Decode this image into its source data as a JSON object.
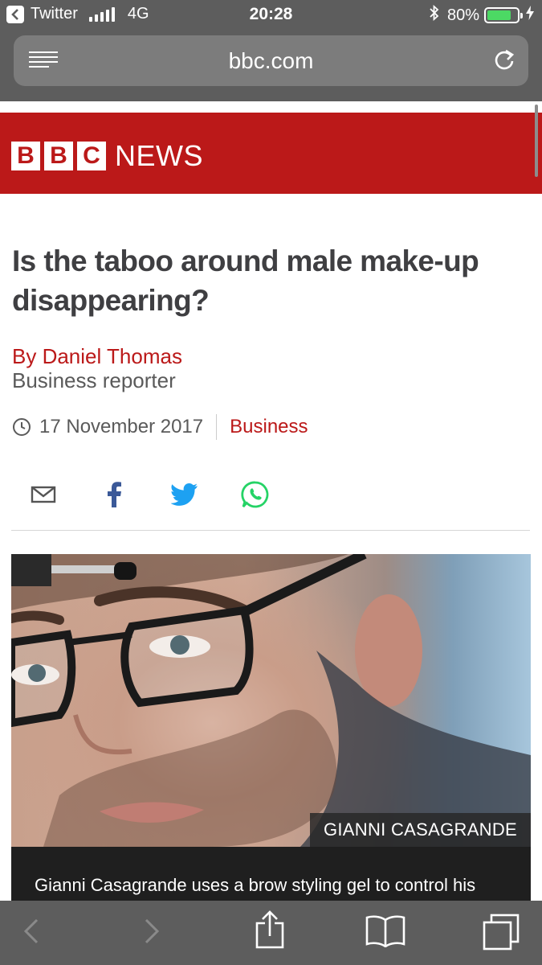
{
  "status_bar": {
    "back_app": "Twitter",
    "network": "4G",
    "time": "20:28",
    "battery": "80%",
    "battery_level": 0.8,
    "battery_color": "#4cd964"
  },
  "browser": {
    "url": "bbc.com"
  },
  "site": {
    "brand_letters": [
      "B",
      "B",
      "C"
    ],
    "brand_word": "NEWS",
    "brand_color": "#bb1919"
  },
  "article": {
    "headline": "Is the taboo around male make-up disappearing?",
    "author": "By Daniel Thomas",
    "author_role": "Business reporter",
    "date": "17 November 2017",
    "section": "Business"
  },
  "share": {
    "icons": [
      "email-icon",
      "facebook-icon",
      "twitter-icon",
      "whatsapp-icon"
    ],
    "twitter_color": "#1da1f2",
    "facebook_color": "#3b5998",
    "whatsapp_color": "#25d366"
  },
  "image": {
    "credit": "GIANNI CASAGRANDE",
    "caption": "Gianni Casagrande uses a brow styling gel to control his"
  },
  "toolbar": {
    "icons": [
      "back-icon",
      "forward-icon",
      "share-icon",
      "bookmarks-icon",
      "tabs-icon"
    ]
  }
}
